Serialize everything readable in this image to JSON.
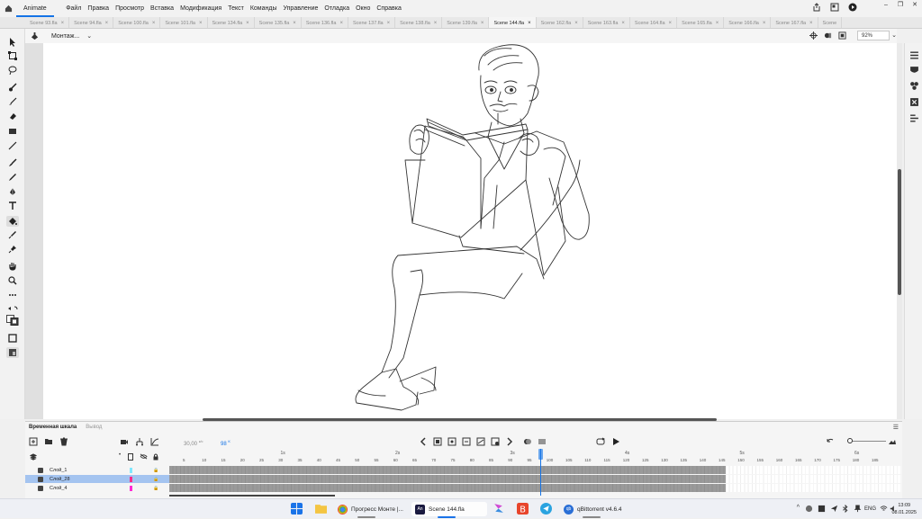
{
  "app": {
    "name": "Animate",
    "menu": [
      "Файл",
      "Правка",
      "Просмотр",
      "Вставка",
      "Модификация",
      "Текст",
      "Команды",
      "Управление",
      "Отладка",
      "Окно",
      "Справка"
    ]
  },
  "tabs": [
    {
      "label": "Scene 93.fla",
      "active": false
    },
    {
      "label": "Scene 94.fla",
      "active": false
    },
    {
      "label": "Scene 100.fla",
      "active": false
    },
    {
      "label": "Scene 101.fla",
      "active": false
    },
    {
      "label": "Scene 134.fla",
      "active": false
    },
    {
      "label": "Scene 135.fla",
      "active": false
    },
    {
      "label": "Scene 136.fla",
      "active": false
    },
    {
      "label": "Scene 137.fla",
      "active": false
    },
    {
      "label": "Scene 138.fla",
      "active": false
    },
    {
      "label": "Scene 139.fla",
      "active": false
    },
    {
      "label": "Scene 144.fla",
      "active": true
    },
    {
      "label": "Scene 162.fla",
      "active": false
    },
    {
      "label": "Scene 163.fla",
      "active": false
    },
    {
      "label": "Scene 164.fla",
      "active": false
    },
    {
      "label": "Scene 165.fla",
      "active": false
    },
    {
      "label": "Scene 166.fla",
      "active": false
    },
    {
      "label": "Scene 167.fla",
      "active": false
    },
    {
      "label": "Scene",
      "active": false
    }
  ],
  "tab_close": "×",
  "editbar": {
    "scene_name": "Монтаж...",
    "zoom": "92%"
  },
  "timeline": {
    "tab_label": "Временная шкала",
    "output_label": "Вывод",
    "fps": "30,00",
    "fps_unit": "к/с",
    "current_frame": "98",
    "current_frame_unit": "К",
    "ruler": [
      "5",
      "10",
      "15",
      "20",
      "25",
      "30",
      "35",
      "40",
      "45",
      "50",
      "55",
      "60",
      "65",
      "70",
      "75",
      "80",
      "85",
      "90",
      "95",
      "100",
      "105",
      "110",
      "115",
      "120",
      "125",
      "130",
      "135",
      "140",
      "145",
      "150",
      "155",
      "160",
      "165",
      "170",
      "175",
      "180",
      "185"
    ],
    "seconds": [
      "1s",
      "2s",
      "3s",
      "4s",
      "5s",
      "6s"
    ],
    "layers": [
      {
        "name": "Слой_1",
        "selected": false,
        "color": "#7fe8ff"
      },
      {
        "name": "Слой_28",
        "selected": true,
        "color": "#ff2a8a"
      },
      {
        "name": "Слой_4",
        "selected": false,
        "color": "#ff2ad4"
      }
    ]
  },
  "taskbar": {
    "items": [
      {
        "label": "Прогресс Монте |...",
        "active": false
      },
      {
        "label": "Scene 144.fla",
        "active": true
      },
      {
        "label": "qBittorrent v4.6.4",
        "active": false
      }
    ],
    "lang": "ENG",
    "time": "13:09",
    "date": "08.01.2025"
  },
  "colors": {
    "accent": "#1473e6",
    "stage": "#ffffff",
    "selected_layer": "#a4c4f0"
  }
}
